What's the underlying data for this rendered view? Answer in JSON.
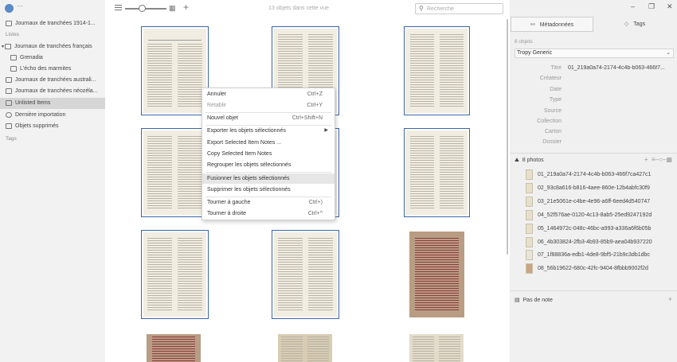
{
  "app": {
    "title_dots": "···"
  },
  "sidebar": {
    "projects": [
      {
        "label": "Journaux de tranchées 1914-1..."
      }
    ],
    "lists_header": "Listes",
    "lists": [
      {
        "label": "Journaux de tranchées français",
        "expanded": true
      },
      {
        "label": "Grenadia",
        "child": true
      },
      {
        "label": "L'écho des marmites",
        "child": true
      },
      {
        "label": "Journaux de tranchées australi..."
      },
      {
        "label": "Journaux de tranchées néozéla..."
      },
      {
        "label": "Unlisted Items",
        "selected": true
      },
      {
        "label": "Dernière importation"
      },
      {
        "label": "Objets supprimés"
      }
    ],
    "tags_header": "Tags"
  },
  "toolbar": {
    "item_count": "13 objets dans cette vue",
    "search_placeholder": "Recherche",
    "zoom_level_fraction": 0.55
  },
  "context_menu": {
    "items": [
      {
        "label": "Annuler",
        "shortcut": "Ctrl+Z",
        "disabled": false
      },
      {
        "label": "Rétablir",
        "shortcut": "Ctrl+Y",
        "disabled": true
      },
      {
        "separator": true
      },
      {
        "label": "Nouvel objet",
        "shortcut": "Ctrl+Shift+N"
      },
      {
        "separator": true
      },
      {
        "label": "Exporter les objets sélectionnés",
        "submenu": true
      },
      {
        "label": "Export Selected Item Notes ..."
      },
      {
        "label": "Copy Selected Item Notes"
      },
      {
        "label": "Regrouper les objets sélectionnés"
      },
      {
        "separator": true
      },
      {
        "label": "Fusionner les objets sélectionnés",
        "highlighted": true
      },
      {
        "label": "Supprimer les objets sélectionnés"
      },
      {
        "separator": true
      },
      {
        "label": "Tourner à gauche",
        "shortcut": "Ctrl+)"
      },
      {
        "label": "Tourner à droite",
        "shortcut": "Ctrl+^"
      }
    ]
  },
  "right_panel": {
    "tabs": [
      {
        "label": "Métadonnées",
        "active": true
      },
      {
        "label": "Tags",
        "active": false
      }
    ],
    "selection_count": "8 objets",
    "template": "Tropy Generic",
    "metadata": [
      {
        "label": "Titre",
        "value": "01_219a0a74-2174-4c4b-b063-466f7..."
      },
      {
        "label": "Créateur",
        "value": ""
      },
      {
        "label": "Date",
        "value": ""
      },
      {
        "label": "Type",
        "value": ""
      },
      {
        "label": "Source",
        "value": ""
      },
      {
        "label": "Collection",
        "value": ""
      },
      {
        "label": "Carton",
        "value": ""
      },
      {
        "label": "Dossier",
        "value": ""
      }
    ],
    "photos_header": "8 photos",
    "photos": [
      "01_219a0a74-2174-4c4b-b063-466f7ca427c1",
      "02_93c8a616-b816-4aee-860e-12b4abfc30f9",
      "03_21e5061e-c4be-4e96-a6ff-6eed4d540747",
      "04_52f576ae-0120-4c13-8ab5-25ed9247192d",
      "05_1464972c-048c-46bc-a993-a336a6f6b05b",
      "06_4b303824-2fb3-4b93-85b9-aea04b937220",
      "07_1f88836a-edb1-4de8-9bf5-21b9c3db1dbc",
      "08_56b19622-680c-42fc-9404-8fbbb9002f2d"
    ],
    "notes_header": "Pas de note"
  }
}
